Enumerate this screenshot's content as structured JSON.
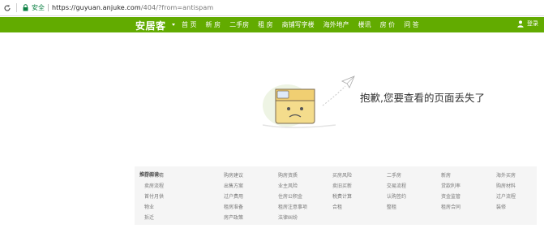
{
  "browser": {
    "reload_icon": "reload-icon",
    "lock_icon": "lock-icon",
    "secure_label": "安全",
    "url_scheme": "https://",
    "url_host": "guyuan.anjuke.com",
    "url_path": "/404/?from=antispam"
  },
  "nav": {
    "logo": "安居客",
    "items": [
      "首 页",
      "新 房",
      "二手房",
      "租 房",
      "商铺写字楼",
      "海外地产",
      "楼讯",
      "房 价",
      "问 答"
    ],
    "login_label": "登录",
    "accent": "#62ab00"
  },
  "error": {
    "message": "抱歉,您要查看的页面丢失了"
  },
  "footer": {
    "label": "推荐阅读:",
    "columns": [
      [
        "房价行情",
        "卖房流程",
        "首付月供",
        "物业",
        "拆迁"
      ],
      [
        "购房建议",
        "出售方案",
        "过户费用",
        "租房准备",
        "房产政策"
      ],
      [
        "购房资质",
        "业主风险",
        "住房公积金",
        "租房注意事项",
        "法律纠纷"
      ],
      [
        "买房风险",
        "卖旧买新",
        "税费计算",
        "合租"
      ],
      [
        "二手房",
        "交易流程",
        "认购签约",
        "整租"
      ],
      [
        "新房",
        "贷款利率",
        "资金监管",
        "租房合同"
      ],
      [
        "海外买房",
        "购房材料",
        "过户流程",
        "装修"
      ]
    ]
  }
}
